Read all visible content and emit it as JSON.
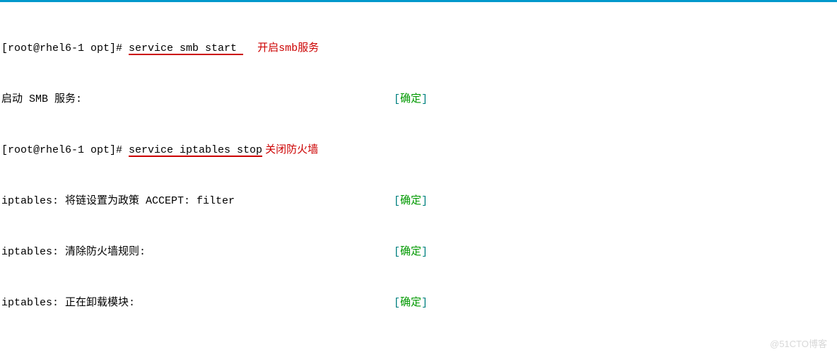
{
  "prompt1_prefix": "[root@rhel6-1 opt]# ",
  "cmd1": "service smb start ",
  "annotation1": "开启smb服务",
  "line2_left": "启动 SMB 服务:",
  "status_open": "[",
  "status_ok": "确定",
  "status_close": "]",
  "prompt2_prefix": "[root@rhel6-1 opt]# ",
  "cmd2": "service iptables stop",
  "annotation2": "关闭防火墙",
  "line4_left": "iptables: 将链设置为政策 ACCEPT: filter",
  "line5_left": "iptables: 清除防火墙规则:",
  "line6_left": "iptables: 正在卸载模块:",
  "watermark": "@51CTO博客"
}
